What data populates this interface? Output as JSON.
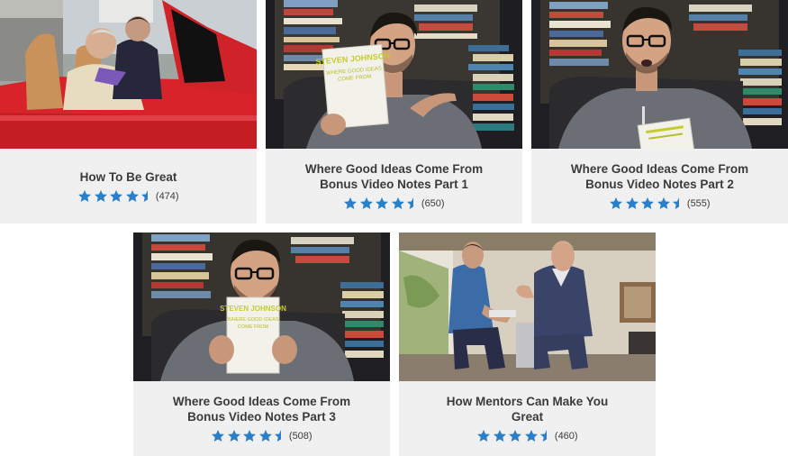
{
  "colors": {
    "card_bg": "#f0f0f0",
    "title": "#3b3b3b",
    "star": "#2a7fc9"
  },
  "videos": [
    {
      "title": "How To Be Great",
      "stars": 4.5,
      "count": "(474)",
      "thumb_icon": "two-men-in-red-convertible-image"
    },
    {
      "title": "Where Good Ideas Come From Bonus Video Notes Part 1",
      "stars": 4.5,
      "count": "(650)",
      "thumb_icon": "man-holding-book-pointing-image"
    },
    {
      "title": "Where Good Ideas Come From Bonus Video Notes Part 2",
      "stars": 4.5,
      "count": "(555)",
      "thumb_icon": "man-talking-with-book-image"
    },
    {
      "title": "Where Good Ideas Come From Bonus Video Notes Part 3",
      "stars": 4.5,
      "count": "(508)",
      "thumb_icon": "man-holding-book-image"
    },
    {
      "title": "How Mentors Can Make You Great",
      "stars": 4.5,
      "count": "(460)",
      "thumb_icon": "two-men-seated-talking-image"
    }
  ],
  "book": {
    "author": "STEVEN JOHNSON",
    "title_line1": "WHERE GOOD IDEAS",
    "title_line2": "COME FROM"
  }
}
